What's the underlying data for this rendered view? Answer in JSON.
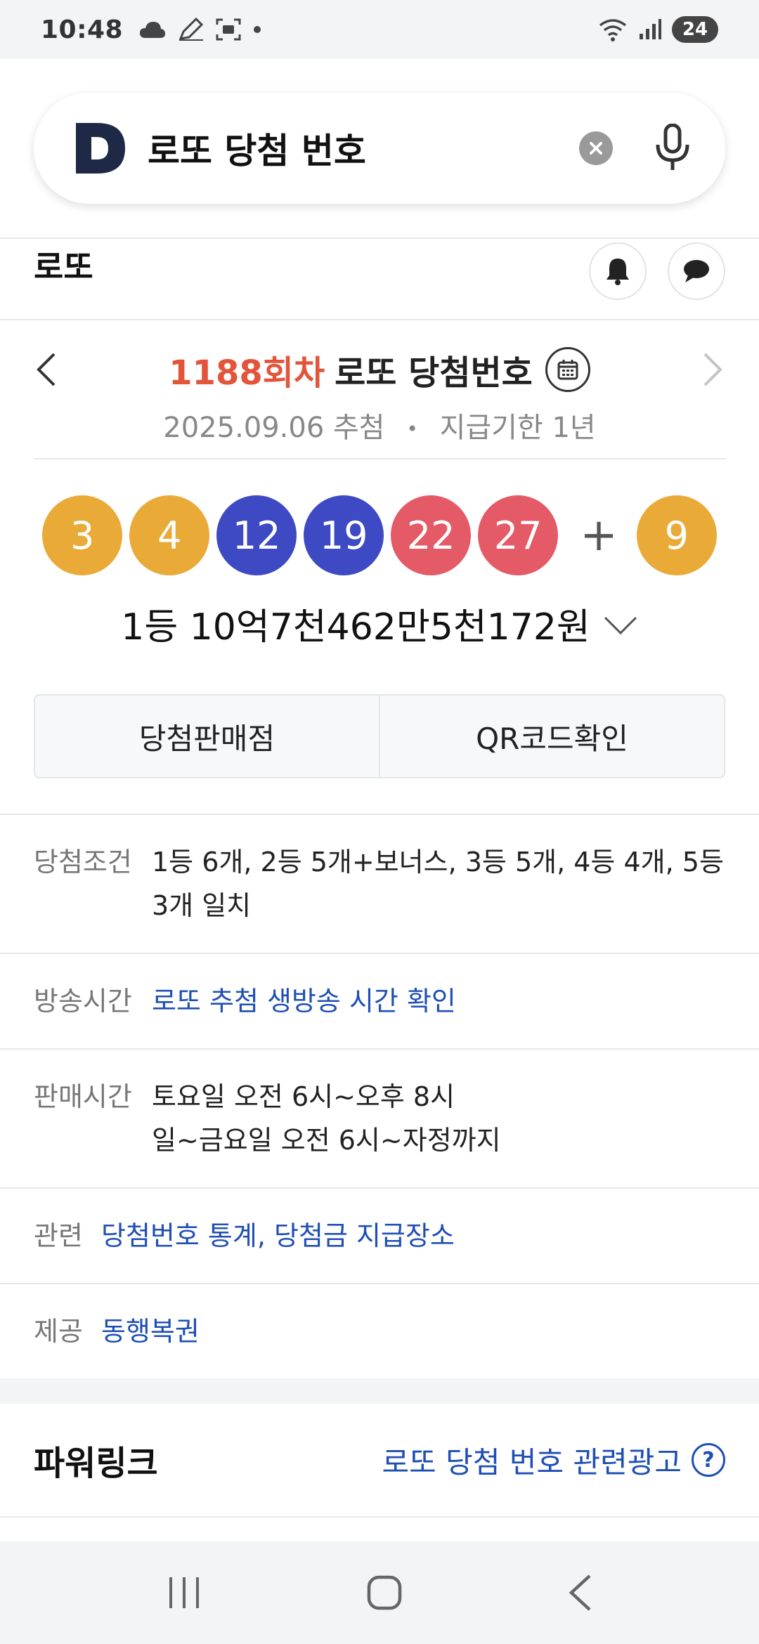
{
  "status": {
    "time": "10:48",
    "battery": "24"
  },
  "search": {
    "query": "로또 당첨 번호"
  },
  "section": {
    "title": "로또"
  },
  "draw": {
    "round": "1188회차",
    "label": "로또 당첨번호",
    "date_text": "2025.09.06 추첨",
    "separator": "•",
    "expiry_text": "지급기한 1년",
    "numbers": [
      {
        "n": "3",
        "color": "#eaaa38"
      },
      {
        "n": "4",
        "color": "#eaaa38"
      },
      {
        "n": "12",
        "color": "#3d4ac4"
      },
      {
        "n": "19",
        "color": "#3d4ac4"
      },
      {
        "n": "22",
        "color": "#e45a66"
      },
      {
        "n": "27",
        "color": "#e45a66"
      }
    ],
    "plus": "+",
    "bonus": {
      "n": "9",
      "color": "#eaaa38"
    },
    "prize": "1등 10억7천462만5천172원"
  },
  "actions": {
    "stores": "당첨판매점",
    "qr": "QR코드확인"
  },
  "info": {
    "conditions_key": "당첨조건",
    "conditions_val": "1등 6개, 2등 5개+보너스, 3등 5개, 4등 4개, 5등 3개 일치",
    "broadcast_key": "방송시간",
    "broadcast_val": "로또 추첨 생방송 시간 확인",
    "sales_key": "판매시간",
    "sales_line1": "토요일 오전 6시~오후 8시",
    "sales_line2": "일~금요일 오전 6시~자정까지",
    "related_key": "관련",
    "related_link1": "당첨번호 통계",
    "related_sep": ", ",
    "related_link2": "당첨금 지급장소",
    "provider_key": "제공",
    "provider_val": "동행복권"
  },
  "powerlink": {
    "title": "파워링크",
    "ad_text": "로또 당첨 번호 관련광고",
    "help": "?"
  },
  "icons": {
    "logo": "daum-d-logo-icon",
    "clear": "clear-icon",
    "mic": "mic-icon",
    "bell": "bell-icon",
    "chat": "chat-icon",
    "calendar": "calendar-icon",
    "prev": "chevron-left-icon",
    "next": "chevron-right-icon",
    "expand": "chevron-down-icon"
  },
  "colors": {
    "accent_red": "#e2553b",
    "link_blue": "#1f4fb5"
  }
}
